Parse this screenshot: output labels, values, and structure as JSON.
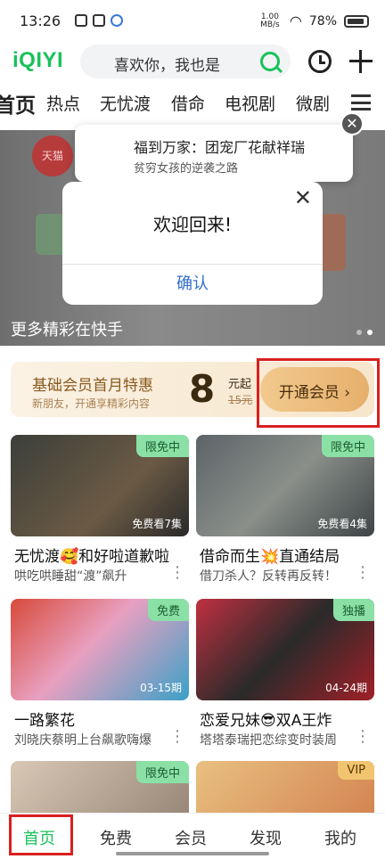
{
  "status_bar": {
    "time": "13:26",
    "net_speed": "1.00 MB/s",
    "battery": "78%"
  },
  "header": {
    "logo": "iQIYI",
    "search_text": "喜欢你，我也是"
  },
  "tabs": [
    "首页",
    "热点",
    "无忧渡",
    "借命",
    "电视剧",
    "微剧"
  ],
  "banner": {
    "caption": "更多精彩在快手",
    "avatar_label": "天猫"
  },
  "notification": {
    "title": "福到万家：团宠厂花献祥瑞",
    "subtitle": "贫穷女孩的逆袭之路"
  },
  "dialog": {
    "message": "欢迎回来!",
    "confirm": "确认"
  },
  "member": {
    "title": "基础会员首月特惠",
    "subtitle": "新朋友，开通享精彩内容",
    "price": "8",
    "price_unit": "元起",
    "original_price": "15元",
    "button": "开通会员 ›"
  },
  "cards": [
    {
      "badge": "限免中",
      "overlay": "免费看7集",
      "title": "无忧渡🥰和好啦道歉啦",
      "desc": "哄吃哄睡甜“渡”飙升"
    },
    {
      "badge": "限免中",
      "overlay": "免费看4集",
      "title": "借命而生💥直通结局",
      "desc": "借刀杀人？反转再反转！"
    },
    {
      "badge": "免费",
      "overlay": "03-15期",
      "title": "一路繁花",
      "desc": "刘晓庆蔡明上台飙歌嗨爆"
    },
    {
      "badge": "独播",
      "overlay": "04-24期",
      "title": "恋爱兄妹😎双A王炸",
      "desc": "塔塔泰瑞把恋综变时装周"
    },
    {
      "badge": "限免中",
      "overlay": "",
      "title": "",
      "desc": ""
    },
    {
      "badge": "VIP",
      "overlay": "",
      "title": "",
      "desc": ""
    }
  ],
  "bottom_nav": [
    "首页",
    "免费",
    "会员",
    "发现",
    "我的"
  ],
  "colors": {
    "accent": "#19c25a",
    "highlight_box": "#d8201f"
  }
}
